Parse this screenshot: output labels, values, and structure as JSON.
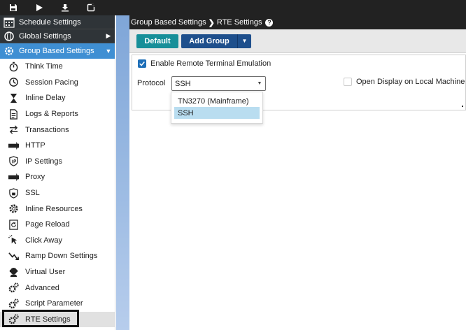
{
  "toolbar": {
    "icons": [
      "save-icon",
      "play-icon",
      "download-icon",
      "edit-icon"
    ]
  },
  "sidebar": {
    "top_items": [
      {
        "label": "Schedule Settings",
        "icon": "schedule-icon",
        "arrow": ""
      },
      {
        "label": "Global Settings",
        "icon": "globe-icon",
        "arrow": "▶"
      },
      {
        "label": "Group Based Settings",
        "icon": "group-gear-icon",
        "arrow": "▼"
      }
    ],
    "items": [
      {
        "label": "Think Time",
        "icon": "stopwatch-icon"
      },
      {
        "label": "Session Pacing",
        "icon": "timer-icon"
      },
      {
        "label": "Inline Delay",
        "icon": "hourglass-icon"
      },
      {
        "label": "Logs & Reports",
        "icon": "document-icon"
      },
      {
        "label": "Transactions",
        "icon": "arrows-icon"
      },
      {
        "label": "HTTP",
        "icon": "http-icon"
      },
      {
        "label": "IP Settings",
        "icon": "ip-shield-icon"
      },
      {
        "label": "Proxy",
        "icon": "proxy-icon"
      },
      {
        "label": "SSL",
        "icon": "ssl-shield-icon"
      },
      {
        "label": "Inline Resources",
        "icon": "gear-icon"
      },
      {
        "label": "Page Reload",
        "icon": "reload-icon"
      },
      {
        "label": "Click Away",
        "icon": "cursor-icon"
      },
      {
        "label": "Ramp Down Settings",
        "icon": "ramp-down-icon"
      },
      {
        "label": "Virtual User",
        "icon": "user-icon"
      },
      {
        "label": "Advanced",
        "icon": "gears-icon"
      },
      {
        "label": "Script Parameter",
        "icon": "gears-icon"
      },
      {
        "label": "RTE Settings",
        "icon": "gears-icon",
        "active": true
      }
    ]
  },
  "breadcrumb": {
    "parent": "Group Based Settings",
    "separator": "❯",
    "current": "RTE Settings",
    "help": "?"
  },
  "actions": {
    "default_label": "Default",
    "add_group_label": "Add Group",
    "caret": "▼"
  },
  "form": {
    "enable_rte_label": "Enable Remote Terminal Emulation",
    "enable_rte_checked": true,
    "protocol_label": "Protocol",
    "protocol_value": "SSH",
    "protocol_options": [
      "TN3270 (Mainframe)",
      "SSH"
    ],
    "open_display_label": "Open Display on Local Machine",
    "open_display_checked": false
  },
  "colors": {
    "sidebar_active": "#3f8fd3",
    "default_btn": "#178f99",
    "add_btn": "#1e4f8c",
    "checkbox": "#1e6fb8",
    "selected_option": "#b9ddf0"
  }
}
